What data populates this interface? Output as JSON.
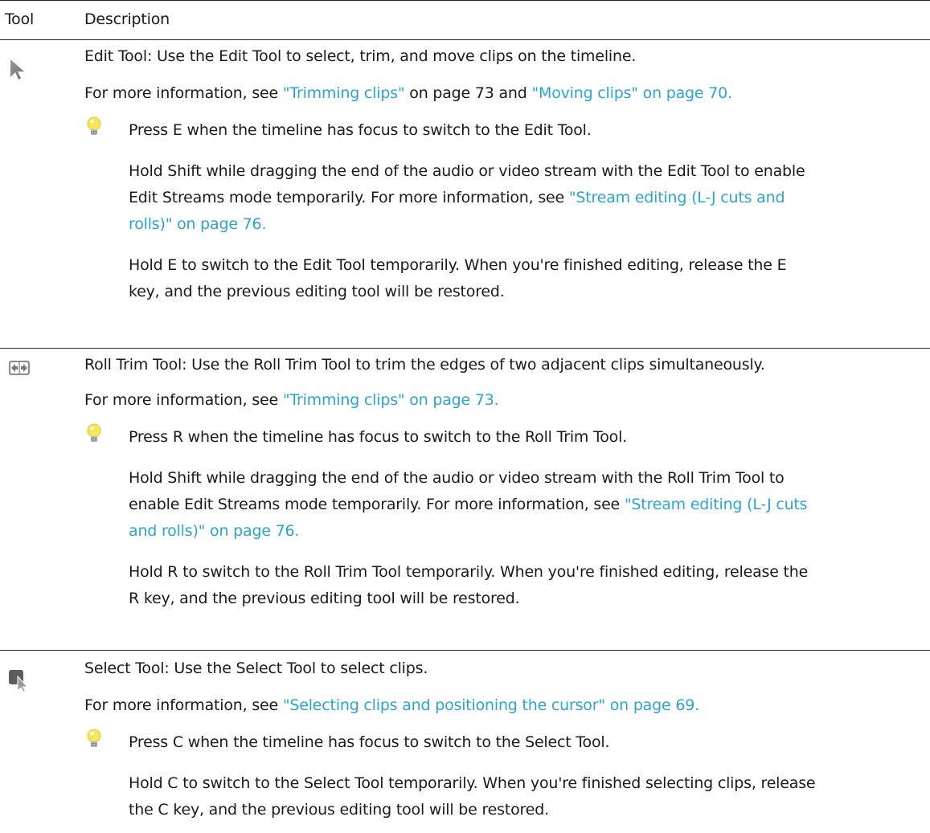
{
  "header": {
    "tool": "Tool",
    "description": "Description"
  },
  "rows": [
    {
      "icon": "arrow-cursor-icon",
      "intro": "Edit Tool: Use the Edit Tool to select, trim, and move clips on the timeline.",
      "more_pre": "For more information, see ",
      "link1": "\"Trimming clips\"",
      "more_mid": " on page 73 and ",
      "link2": "\"Moving clips\" on page 70.",
      "tip": "Press E when the timeline has focus to switch to the Edit Tool.",
      "para1_l1": "Hold Shift while dragging the end of the audio or video stream with the Edit Tool to enable",
      "para1_l2_text": "Edit Streams mode temporarily. For more information, see ",
      "para1_l2_link": "\"Stream editing (L-J cuts and",
      "para1_l3_link": "rolls)\" on page 76.",
      "para2_l1": "Hold E to switch to the Edit Tool temporarily. When you're finished editing, release the E",
      "para2_l2": "key, and the previous editing tool will be restored."
    },
    {
      "icon": "roll-trim-icon",
      "intro": "Roll Trim Tool: Use the Roll Trim Tool to trim the edges of two adjacent clips simultaneously.",
      "more_pre": "For more information, see ",
      "link1": "\"Trimming clips\" on page 73.",
      "tip": "Press R when the timeline has focus to switch to the Roll Trim Tool.",
      "para1_l1": "Hold Shift while dragging the end of the audio or video stream with the Roll Trim Tool to",
      "para1_l2_text": "enable Edit Streams mode temporarily. For more information, see ",
      "para1_l2_link": "\"Stream editing (L-J cuts",
      "para1_l3_link": "and rolls)\" on page 76.",
      "para2_l1": "Hold R to switch to the Roll Trim Tool temporarily. When you're finished editing, release the",
      "para2_l2": "R key, and the previous editing tool will be restored."
    },
    {
      "icon": "select-tool-icon",
      "intro": "Select Tool: Use the Select Tool to select clips.",
      "more_pre": "For more information, see ",
      "link1": "\"Selecting clips and positioning the cursor\" on page 69.",
      "tip": "Press C when the timeline has focus to switch to the Select Tool.",
      "para2_l1": "Hold C to switch to the Select Tool temporarily. When you're finished selecting clips, release",
      "para2_l2": "the C key, and the previous editing tool will be restored."
    }
  ]
}
